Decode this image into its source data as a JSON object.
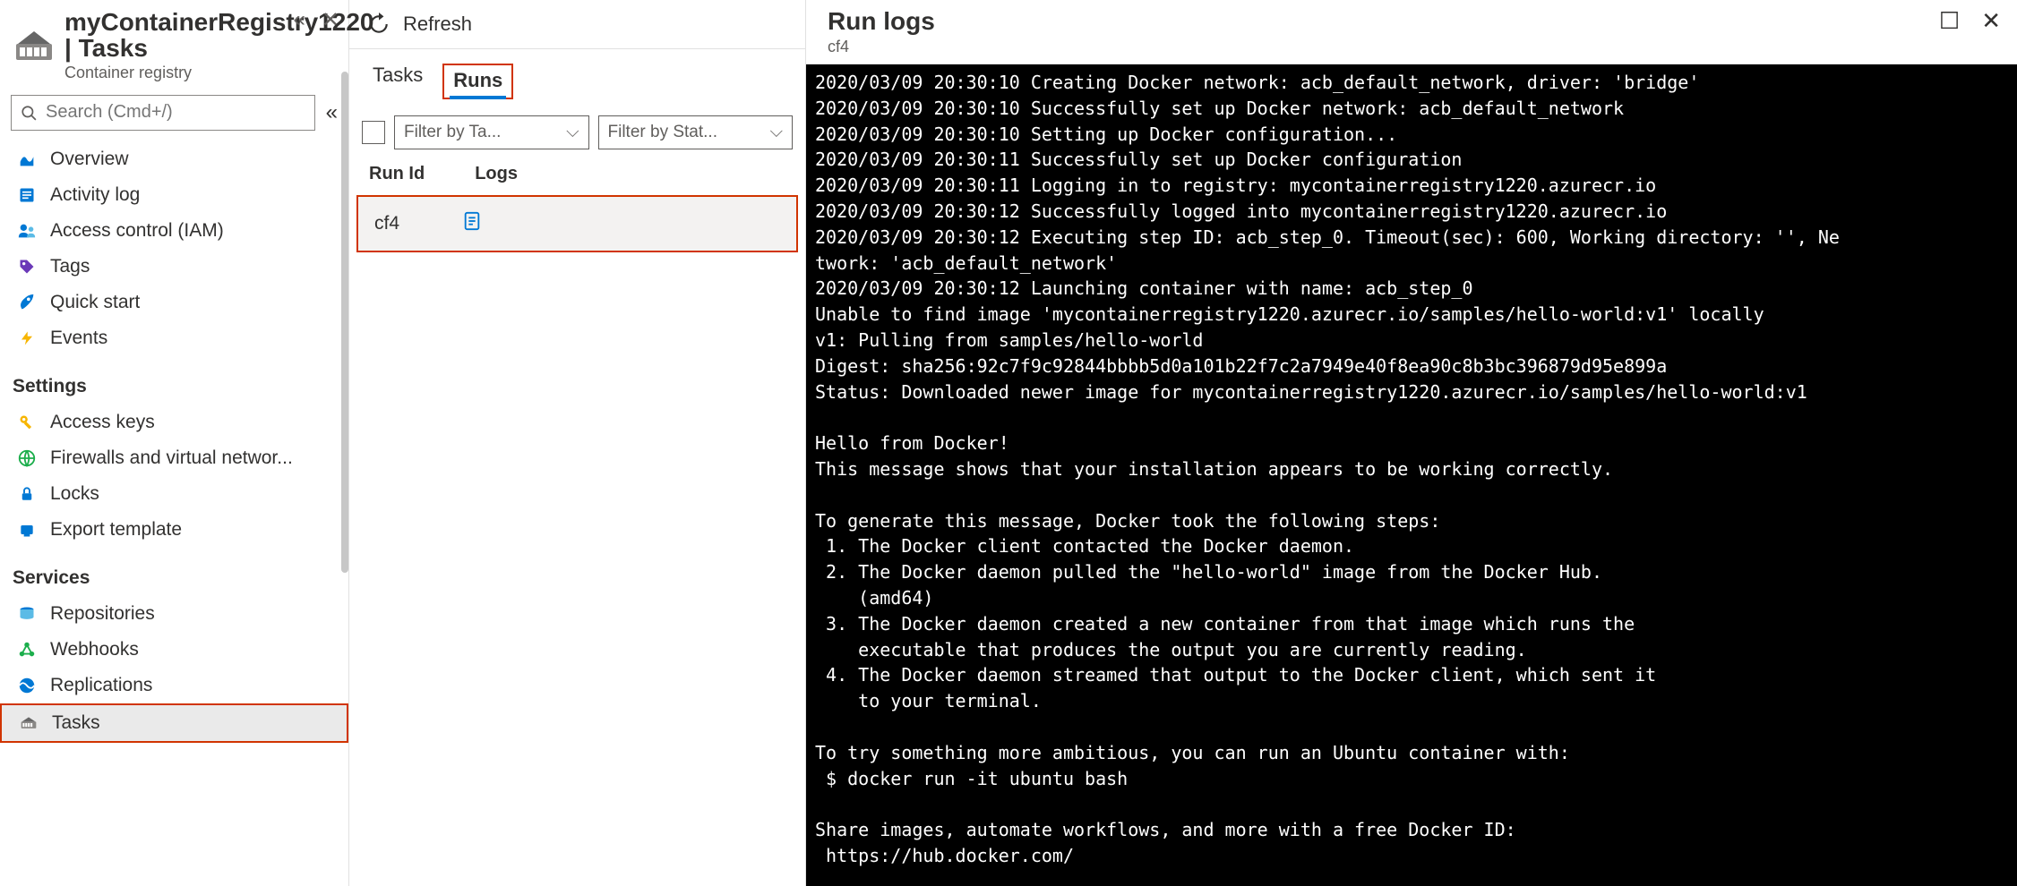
{
  "header": {
    "title": "myContainerRegistry1220 | Tasks",
    "subtitle": "Container registry"
  },
  "search": {
    "placeholder": "Search (Cmd+/)"
  },
  "nav": {
    "items_top": [
      {
        "label": "Overview"
      },
      {
        "label": "Activity log"
      },
      {
        "label": "Access control (IAM)"
      },
      {
        "label": "Tags"
      },
      {
        "label": "Quick start"
      },
      {
        "label": "Events"
      }
    ],
    "group_settings": "Settings",
    "items_settings": [
      {
        "label": "Access keys"
      },
      {
        "label": "Firewalls and virtual networ..."
      },
      {
        "label": "Locks"
      },
      {
        "label": "Export template"
      }
    ],
    "group_services": "Services",
    "items_services": [
      {
        "label": "Repositories"
      },
      {
        "label": "Webhooks"
      },
      {
        "label": "Replications"
      },
      {
        "label": "Tasks"
      }
    ]
  },
  "mid": {
    "refresh": "Refresh",
    "tabs": {
      "tasks": "Tasks",
      "runs": "Runs"
    },
    "filter_task": "Filter by Ta...",
    "filter_stat": "Filter by Stat...",
    "col_runid": "Run Id",
    "col_logs": "Logs",
    "row": {
      "runid": "cf4"
    }
  },
  "right": {
    "title": "Run logs",
    "subtitle": "cf4",
    "terminal": "2020/03/09 20:30:10 Creating Docker network: acb_default_network, driver: 'bridge'\n2020/03/09 20:30:10 Successfully set up Docker network: acb_default_network\n2020/03/09 20:30:10 Setting up Docker configuration...\n2020/03/09 20:30:11 Successfully set up Docker configuration\n2020/03/09 20:30:11 Logging in to registry: mycontainerregistry1220.azurecr.io\n2020/03/09 20:30:12 Successfully logged into mycontainerregistry1220.azurecr.io\n2020/03/09 20:30:12 Executing step ID: acb_step_0. Timeout(sec): 600, Working directory: '', Ne\ntwork: 'acb_default_network'\n2020/03/09 20:30:12 Launching container with name: acb_step_0\nUnable to find image 'mycontainerregistry1220.azurecr.io/samples/hello-world:v1' locally\nv1: Pulling from samples/hello-world\nDigest: sha256:92c7f9c92844bbbb5d0a101b22f7c2a7949e40f8ea90c8b3bc396879d95e899a\nStatus: Downloaded newer image for mycontainerregistry1220.azurecr.io/samples/hello-world:v1\n\nHello from Docker!\nThis message shows that your installation appears to be working correctly.\n\nTo generate this message, Docker took the following steps:\n 1. The Docker client contacted the Docker daemon.\n 2. The Docker daemon pulled the \"hello-world\" image from the Docker Hub.\n    (amd64)\n 3. The Docker daemon created a new container from that image which runs the\n    executable that produces the output you are currently reading.\n 4. The Docker daemon streamed that output to the Docker client, which sent it\n    to your terminal.\n\nTo try something more ambitious, you can run an Ubuntu container with:\n $ docker run -it ubuntu bash\n\nShare images, automate workflows, and more with a free Docker ID:\n https://hub.docker.com/"
  }
}
